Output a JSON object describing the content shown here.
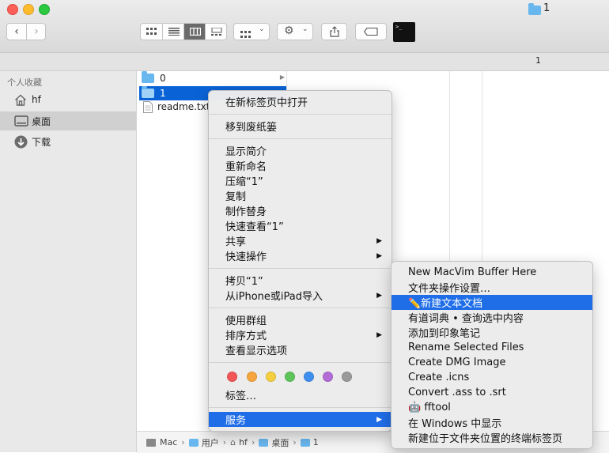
{
  "window": {
    "title": "1"
  },
  "toolbar": {
    "terminal_glyph": ">_"
  },
  "path_header": {
    "label": "1"
  },
  "sidebar": {
    "section_title": "个人收藏",
    "items": [
      {
        "label": "hf",
        "icon": "home-icon"
      },
      {
        "label": "桌面",
        "icon": "desktop-icon",
        "selected": true
      },
      {
        "label": "下载",
        "icon": "download-icon"
      }
    ]
  },
  "column1": {
    "items": [
      {
        "label": "0",
        "type": "folder"
      },
      {
        "label": "1",
        "type": "folder",
        "selected": true
      },
      {
        "label": "readme.txt",
        "type": "file"
      }
    ]
  },
  "context_menu": {
    "open_in_tab": "在新标签页中打开",
    "move_to_trash": "移到废纸篓",
    "get_info": "显示简介",
    "rename": "重新命名",
    "compress": "压缩“1”",
    "duplicate": "复制",
    "make_alias": "制作替身",
    "quick_look": "快速查看“1”",
    "share": "共享",
    "quick_actions": "快速操作",
    "copy": "拷贝“1”",
    "import_iphone": "从iPhone或iPad导入",
    "use_groups": "使用群组",
    "sort_by": "排序方式",
    "show_view_options": "查看显示选项",
    "tags": "标签…",
    "services": "服务",
    "tag_colors": [
      "#f25656",
      "#f5a53c",
      "#f5cf40",
      "#5fc45a",
      "#3f8ff0",
      "#b36cd6",
      "#9a9a9a"
    ]
  },
  "services_menu": {
    "items": [
      "New MacVim Buffer Here",
      "文件夹操作设置…",
      "✏️新建文本文档",
      "有道词典 • 查询选中内容",
      "添加到印象笔记",
      "Rename Selected Files",
      "Create DMG Image",
      "Create .icns",
      "Convert .ass to .srt",
      "🤖 fftool",
      "在 Windows 中显示",
      "新建位于文件夹位置的终端标签页"
    ],
    "highlighted_index": 2
  },
  "pathbar": {
    "segments": [
      "Mac",
      "用户",
      "hf",
      "桌面",
      "1"
    ],
    "separator": "›"
  }
}
